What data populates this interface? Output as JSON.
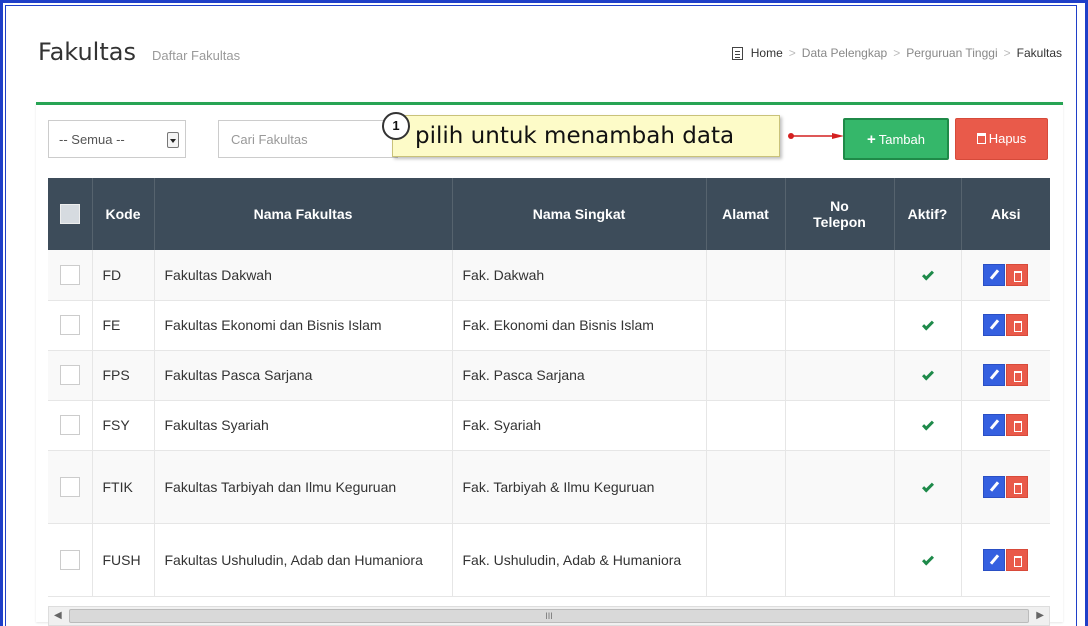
{
  "header": {
    "title": "Fakultas",
    "subtitle": "Daftar Fakultas"
  },
  "breadcrumb": {
    "home": "Home",
    "items": [
      "Data Pelengkap",
      "Perguruan Tinggi"
    ],
    "current": "Fakultas",
    "separator": ">"
  },
  "filter": {
    "select_value": "-- Semua --",
    "search_placeholder": "Cari Fakultas"
  },
  "callout": {
    "number": "1",
    "text": "pilih untuk menambah data"
  },
  "toolbar": {
    "add_label": "Tambah",
    "delete_label": "Hapus"
  },
  "table": {
    "headers": {
      "kode": "Kode",
      "nama": "Nama Fakultas",
      "singkat": "Nama Singkat",
      "alamat": "Alamat",
      "telepon_1": "No",
      "telepon_2": "Telepon",
      "aktif": "Aktif?",
      "aksi": "Aksi"
    },
    "rows": [
      {
        "kode": "FD",
        "nama": "Fakultas Dakwah",
        "singkat": "Fak. Dakwah",
        "alamat": "",
        "telepon": ""
      },
      {
        "kode": "FE",
        "nama": "Fakultas Ekonomi dan Bisnis Islam",
        "singkat": "Fak. Ekonomi dan Bisnis Islam",
        "alamat": "",
        "telepon": ""
      },
      {
        "kode": "FPS",
        "nama": "Fakultas Pasca Sarjana",
        "singkat": "Fak. Pasca Sarjana",
        "alamat": "",
        "telepon": ""
      },
      {
        "kode": "FSY",
        "nama": "Fakultas Syariah",
        "singkat": "Fak. Syariah",
        "alamat": "",
        "telepon": ""
      },
      {
        "kode": "FTIK",
        "nama": "Fakultas Tarbiyah dan Ilmu Keguruan",
        "singkat": "Fak. Tarbiyah & Ilmu Keguruan",
        "alamat": "",
        "telepon": ""
      },
      {
        "kode": "FUSH",
        "nama": "Fakultas Ushuludin, Adab dan Humaniora",
        "singkat": "Fak. Ushuludin, Adab & Humaniora",
        "alamat": "",
        "telepon": ""
      }
    ]
  },
  "scrollbar": {
    "thumb_label": "III"
  },
  "colors": {
    "accent_green": "#35b76a",
    "danger_red": "#e95a4a",
    "header_dark": "#3d4c5a",
    "edit_blue": "#3560e0",
    "frame_blue": "#1f3fc8"
  }
}
